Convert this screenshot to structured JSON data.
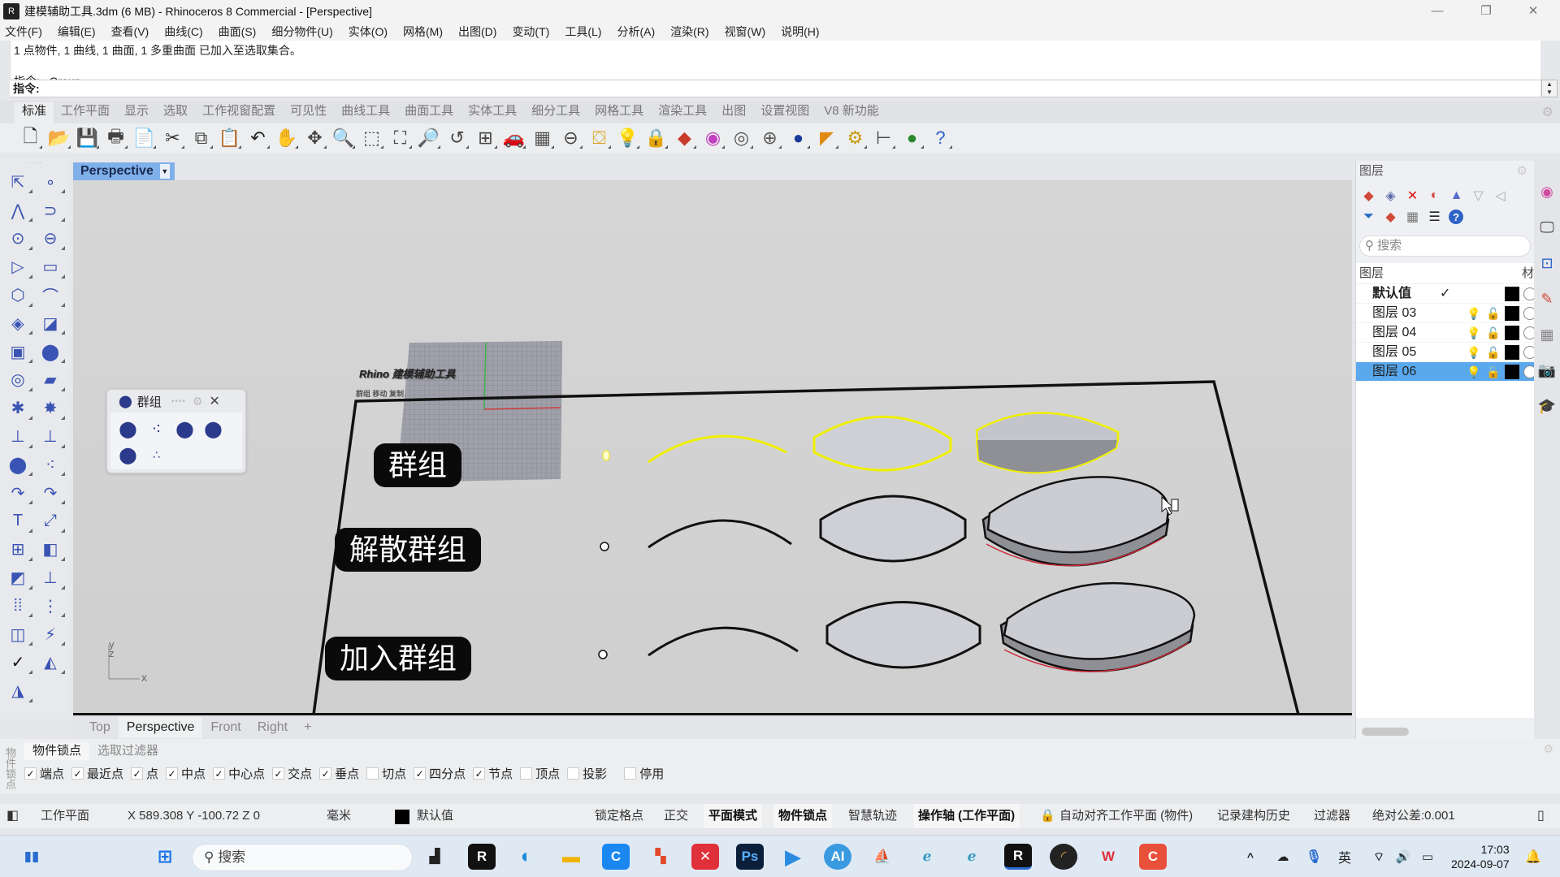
{
  "window": {
    "title": "建模辅助工具.3dm (6 MB) - Rhinoceros 8 Commercial - [Perspective]",
    "controls": {
      "minimize": "—",
      "restore": "❐",
      "close": "✕"
    }
  },
  "menu": [
    "文件(F)",
    "编辑(E)",
    "查看(V)",
    "曲线(C)",
    "曲面(S)",
    "细分物件(U)",
    "实体(O)",
    "网格(M)",
    "出图(D)",
    "变动(T)",
    "工具(L)",
    "分析(A)",
    "渲染(R)",
    "视窗(W)",
    "说明(H)"
  ],
  "command": {
    "history": [
      "1 点物件, 1 曲线, 1 曲面, 1 多重曲面 已加入至选取集合。",
      "指令: _Group"
    ],
    "prompt": "指令:",
    "value": ""
  },
  "toolbar_tabs": [
    "标准",
    "工作平面",
    "显示",
    "选取",
    "工作视窗配置",
    "可见性",
    "曲线工具",
    "曲面工具",
    "实体工具",
    "细分工具",
    "网格工具",
    "渲染工具",
    "出图",
    "设置视图",
    "V8 新功能"
  ],
  "active_toolbar_tab": "标准",
  "toolbar_icons": [
    {
      "name": "new-file-icon",
      "glyph": "🗋"
    },
    {
      "name": "open-folder-icon",
      "glyph": "📂"
    },
    {
      "name": "save-icon",
      "glyph": "💾"
    },
    {
      "name": "print-icon",
      "glyph": "🖶"
    },
    {
      "name": "import-icon",
      "glyph": "📄"
    },
    {
      "name": "cut-icon",
      "glyph": "✂"
    },
    {
      "name": "copy-icon",
      "glyph": "⧉"
    },
    {
      "name": "paste-icon",
      "glyph": "📋"
    },
    {
      "name": "undo-icon",
      "glyph": "↶"
    },
    {
      "name": "pan-hand-icon",
      "glyph": "✋"
    },
    {
      "name": "rotate-view-icon",
      "glyph": "✥"
    },
    {
      "name": "zoom-dynamic-icon",
      "glyph": "🔍"
    },
    {
      "name": "zoom-window-icon",
      "glyph": "⬚"
    },
    {
      "name": "zoom-extents-icon",
      "glyph": "⛶"
    },
    {
      "name": "zoom-selected-icon",
      "glyph": "🔎"
    },
    {
      "name": "undo-view-icon",
      "glyph": "↺"
    },
    {
      "name": "viewport-layout-icon",
      "glyph": "⊞"
    },
    {
      "name": "car-named-views-icon",
      "glyph": "🚗"
    },
    {
      "name": "cplane-icon",
      "glyph": "▦"
    },
    {
      "name": "osnap-icon",
      "glyph": "⊖"
    },
    {
      "name": "select-icon",
      "glyph": "⛋"
    },
    {
      "name": "light-bulb-icon",
      "glyph": "💡"
    },
    {
      "name": "lock-icon",
      "glyph": "🔒"
    },
    {
      "name": "layer-icon",
      "glyph": "◆"
    },
    {
      "name": "color-wheel-icon",
      "glyph": "◉"
    },
    {
      "name": "wireframe-sphere-icon",
      "glyph": "◎"
    },
    {
      "name": "shaded-sphere-icon",
      "glyph": "⊕"
    },
    {
      "name": "rendered-sphere-icon",
      "glyph": "●"
    },
    {
      "name": "spotlight-icon",
      "glyph": "◤"
    },
    {
      "name": "options-gear-icon",
      "glyph": "⚙"
    },
    {
      "name": "dimension-icon",
      "glyph": "⊢"
    },
    {
      "name": "grasshopper-icon",
      "glyph": "●"
    },
    {
      "name": "help-icon",
      "glyph": "?"
    }
  ],
  "viewport": {
    "title": "Perspective",
    "labels": {
      "group": "群组",
      "ungroup": "解散群组",
      "add_to_group": "加入群组"
    },
    "sign_title": "Rhino 建模辅助工具",
    "sign_sub": "群组 移动 复制",
    "axis": {
      "x": "x",
      "y": "y",
      "z": "z"
    }
  },
  "group_panel": {
    "title": "群组",
    "buttons": [
      "group-icon",
      "ungroup-icon",
      "add-to-group-icon",
      "remove-from-group-icon",
      "set-group-name-icon",
      "select-group-icon"
    ]
  },
  "view_tabs": [
    "Top",
    "Perspective",
    "Front",
    "Right"
  ],
  "active_view_tab": "Perspective",
  "add_view": "+",
  "layers": {
    "panel_title": "图层",
    "search_placeholder": "搜索",
    "col_layer": "图层",
    "col_material": "材",
    "rows": [
      {
        "name": "默认值",
        "current": true,
        "selected": false,
        "color": "#000000"
      },
      {
        "name": "图层 03",
        "current": false,
        "selected": false,
        "color": "#000000"
      },
      {
        "name": "图层 04",
        "current": false,
        "selected": false,
        "color": "#000000"
      },
      {
        "name": "图层 05",
        "current": false,
        "selected": false,
        "color": "#000000"
      },
      {
        "name": "图层 06",
        "current": false,
        "selected": true,
        "color": "#000000"
      }
    ]
  },
  "osnap": {
    "side_label": "物件锁点",
    "tabs": [
      "物件锁点",
      "选取过滤器"
    ],
    "active_tab": "物件锁点",
    "options": [
      {
        "label": "端点",
        "checked": true
      },
      {
        "label": "最近点",
        "checked": true
      },
      {
        "label": "点",
        "checked": true
      },
      {
        "label": "中点",
        "checked": true
      },
      {
        "label": "中心点",
        "checked": true
      },
      {
        "label": "交点",
        "checked": true
      },
      {
        "label": "垂点",
        "checked": true
      },
      {
        "label": "切点",
        "checked": false
      },
      {
        "label": "四分点",
        "checked": true
      },
      {
        "label": "节点",
        "checked": true
      },
      {
        "label": "顶点",
        "checked": false
      },
      {
        "label": "投影",
        "checked": false
      },
      {
        "label": "停用",
        "checked": false
      }
    ]
  },
  "status": {
    "cplane": "工作平面",
    "coords": "X 589.308 Y -100.72 Z 0",
    "units": "毫米",
    "layer": "默认值",
    "toggles": [
      {
        "label": "锁定格点",
        "on": false
      },
      {
        "label": "正交",
        "on": false
      },
      {
        "label": "平面模式",
        "on": true
      },
      {
        "label": "物件锁点",
        "on": true
      },
      {
        "label": "智慧轨迹",
        "on": false
      },
      {
        "label": "操作轴 (工作平面)",
        "on": true
      },
      {
        "label": "自动对齐工作平面 (物件)",
        "on": false
      },
      {
        "label": "记录建构历史",
        "on": false
      },
      {
        "label": "过滤器",
        "on": false
      }
    ],
    "tolerance": "绝对公差:0.001"
  },
  "taskbar": {
    "search_placeholder": "搜索",
    "ime": "英",
    "time": "17:03",
    "date": "2024-09-07"
  }
}
